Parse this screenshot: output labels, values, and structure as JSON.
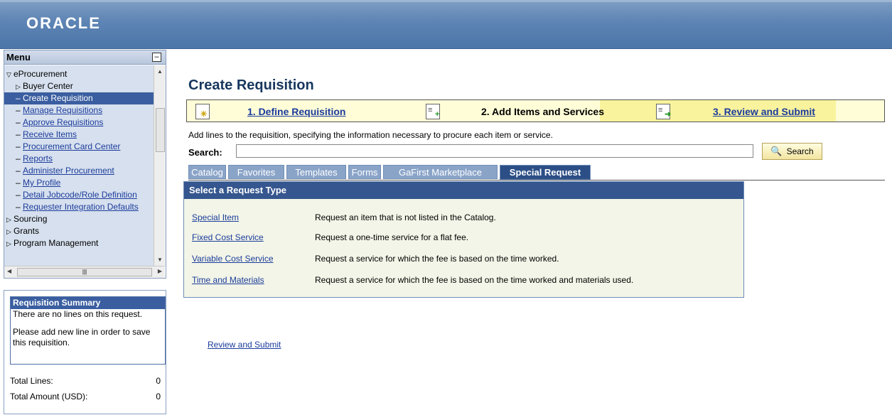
{
  "header": {
    "logo": "ORACLE"
  },
  "menu": {
    "title": "Menu",
    "items": [
      {
        "label": "eProcurement",
        "level": 1,
        "marker": "▽"
      },
      {
        "label": "Buyer Center",
        "level": 2,
        "marker": "▷"
      },
      {
        "label": "Create Requisition",
        "level": 2,
        "marker": "–",
        "selected": true
      },
      {
        "label": "Manage Requisitions",
        "level": 2,
        "marker": "–",
        "link": true
      },
      {
        "label": "Approve Requisitions",
        "level": 2,
        "marker": "–",
        "link": true
      },
      {
        "label": "Receive Items",
        "level": 2,
        "marker": "–",
        "link": true
      },
      {
        "label": "Procurement Card Center",
        "level": 2,
        "marker": "–",
        "link": true
      },
      {
        "label": "Reports",
        "level": 2,
        "marker": "–",
        "link": true
      },
      {
        "label": "Administer Procurement",
        "level": 2,
        "marker": "–",
        "link": true
      },
      {
        "label": "My Profile",
        "level": 2,
        "marker": "–",
        "link": true
      },
      {
        "label": "Detail Jobcode/Role Definition",
        "level": 2,
        "marker": "–",
        "link": true
      },
      {
        "label": "Requester Integration Defaults",
        "level": 2,
        "marker": "–",
        "link": true
      },
      {
        "label": "Sourcing",
        "level": 1,
        "marker": "▷"
      },
      {
        "label": "Grants",
        "level": 1,
        "marker": "▷"
      },
      {
        "label": "Program Management",
        "level": 1,
        "marker": "▷"
      }
    ]
  },
  "summary": {
    "title": "Requisition Summary",
    "line1": "There are no lines on this request.",
    "line2": "Please add new line in order to save this requisition.",
    "total_lines_label": "Total Lines:",
    "total_lines_value": "0",
    "total_amount_label": "Total Amount (USD):",
    "total_amount_value": "0"
  },
  "page": {
    "title": "Create Requisition",
    "steps": [
      {
        "label": "1. Define Requisition",
        "active": false
      },
      {
        "label": "2. Add Items and Services",
        "active": true
      },
      {
        "label": "3. Review and Submit",
        "active": false
      }
    ],
    "description": "Add lines to the requisition, specifying the information necessary to procure each item or service.",
    "search_label": "Search:",
    "search_value": "",
    "search_button": "Search",
    "tabs": [
      "Catalog",
      "Favorites",
      "Templates",
      "Forms",
      "GaFirst Marketplace",
      "Special Request"
    ],
    "active_tab": "Special Request",
    "request_panel_title": "Select a Request Type",
    "request_types": [
      {
        "name": "Special Item",
        "description": "Request an item that is not listed in the Catalog."
      },
      {
        "name": "Fixed Cost Service",
        "description": "Request a one-time service for a flat fee."
      },
      {
        "name": "Variable Cost Service",
        "description": "Request a service for which the fee is based on the time worked."
      },
      {
        "name": "Time and Materials",
        "description": "Request a service for which the fee is based on the time worked and materials used."
      }
    ],
    "review_link": "Review and Submit"
  }
}
